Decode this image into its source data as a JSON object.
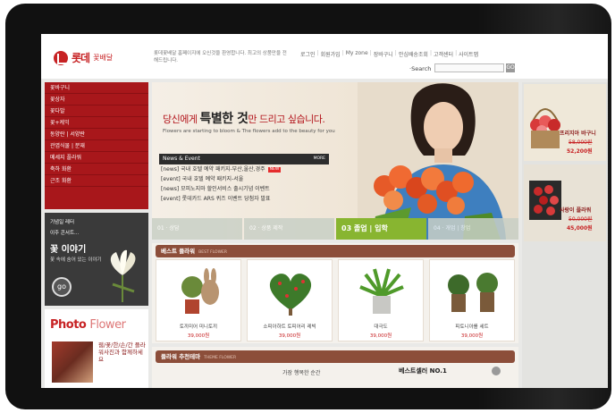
{
  "header": {
    "logo_name": "롯데",
    "logo_sub": "꽃배달",
    "intro": "롯데꽃배달 홈페이지에 오신것을 환영합니다. 최고의 상품만을 전해드립니다.",
    "nav": [
      "로그인",
      "회원가입",
      "My zone",
      "장바구니",
      "안심배송조회",
      "고객센터",
      "사이트맵"
    ],
    "search_label": "·Search",
    "search_value": "",
    "search_btn": "GO"
  },
  "left_menu": [
    "꽃바구니",
    "꽃상자",
    "꽃다발",
    "꽃+케익",
    "동양란 | 서양란",
    "관엽식물 | 분재",
    "메세지 플라워",
    "축하 화환",
    "근조 화환"
  ],
  "story": {
    "line1": "기념일 레터",
    "line2": "이주 콘서트...",
    "title": "꽃 이야기",
    "desc": "꽃 속에 숨어 있는 이야기",
    "go": "go"
  },
  "photo": {
    "title_bold": "Photo",
    "title_light": "Flower",
    "desc": "웹/꽃/한/손/간 플라워사진과 함께하세요"
  },
  "hero": {
    "headline_pre": "당신에게",
    "headline_em": "특별한 것",
    "headline_post": "만 드리고 싶습니다.",
    "subline": "Flowers are starting to bloom & The flowers add to the beauty for you",
    "news_title": "News & Event",
    "news_more": "MORE",
    "news": [
      {
        "text": "[news] 국내 호텔 예약 패키지-부산,울산,경주",
        "is_new": true,
        "badge": "NEW"
      },
      {
        "text": "[event] 국내 호텔 예약 패키지-서울",
        "is_new": false,
        "badge": ""
      },
      {
        "text": "[news] 모피노지마 할인서비스 출시기념 이벤트",
        "is_new": false,
        "badge": ""
      },
      {
        "text": "[event] 롯데카드 ARS 퀴즈 이벤트 당첨자 발표",
        "is_new": false,
        "badge": ""
      }
    ]
  },
  "steps": [
    {
      "label": "01 · 상담",
      "active": false
    },
    {
      "label": "02 · 상품 제작",
      "active": false
    },
    {
      "label": "03  졸업 | 입학",
      "active": true
    },
    {
      "label": "04 · 개업 | 창업",
      "active": false
    }
  ],
  "best": {
    "title": "베스트 플라워",
    "title_en": "BEST FLOWER",
    "items": [
      {
        "name": "토끼미어 미니토끼",
        "price": "39,000원"
      },
      {
        "name": "소피아하트 토피어리 레빅",
        "price": "39,000원"
      },
      {
        "name": "대극도",
        "price": "39,000원"
      },
      {
        "name": "피토니아를 세트",
        "price": "39,000원"
      }
    ]
  },
  "theme": {
    "title": "플라워 추천테마",
    "title_en": "THEME FLOWER",
    "item1": "가장 행복한 순간",
    "item2": "베스트셀러 NO.1"
  },
  "promos": [
    {
      "name": "프리지아 바구니",
      "old": "58,000원",
      "new": "52,200원"
    },
    {
      "name": "사랑이 플라워",
      "old": "50,000원",
      "new": "45,000원"
    }
  ],
  "colors": {
    "brand_red": "#c72224",
    "menu_red": "#a8171b",
    "section_brown": "#8c4e3a",
    "step_green": "#88b530"
  }
}
